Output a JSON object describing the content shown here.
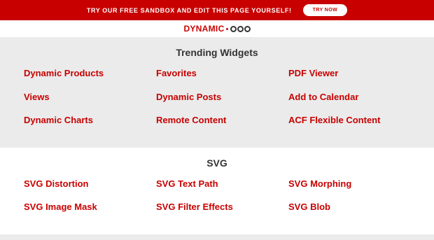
{
  "promo": {
    "text": "TRY OUR FREE SANDBOX AND EDIT THIS PAGE YOURSELF!",
    "button_label": "TRY NOW"
  },
  "logo": {
    "text": "DYNAMIC"
  },
  "trending": {
    "title": "Trending Widgets",
    "links": [
      "Dynamic Products",
      "Favorites",
      "PDF Viewer",
      "Views",
      "Dynamic Posts",
      "Add to Calendar",
      "Dynamic Charts",
      "Remote Content",
      "ACF Flexible Content"
    ]
  },
  "svg": {
    "title": "SVG",
    "links": [
      "SVG Distortion",
      "SVG Text Path",
      "SVG Morphing",
      "SVG Image Mask",
      "SVG Filter Effects",
      "SVG Blob"
    ]
  },
  "colors": {
    "brand_red": "#c80000",
    "section_gray": "#ebebeb",
    "heading_dark": "#333333"
  }
}
